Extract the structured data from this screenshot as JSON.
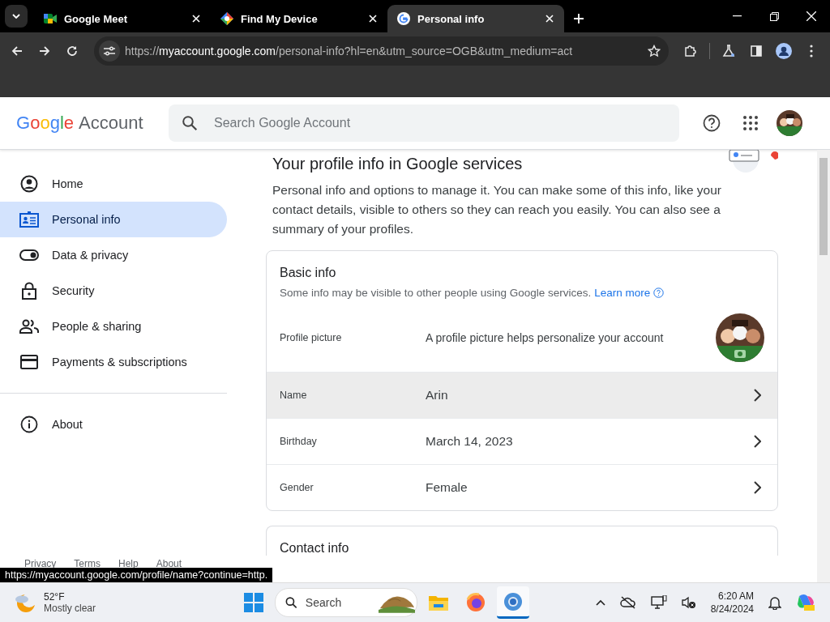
{
  "browser": {
    "tabs": [
      {
        "title": "Google Meet",
        "selected": false
      },
      {
        "title": "Find My Device",
        "selected": false
      },
      {
        "title": "Personal info",
        "selected": true
      }
    ],
    "url": {
      "scheme": "https://",
      "host": "myaccount.google.com",
      "path": "/personal-info?hl=en&utm_source=OGB&utm_medium=act"
    }
  },
  "header": {
    "logo": "Google",
    "product": "Account",
    "search_placeholder": "Search Google Account"
  },
  "sidebar": {
    "items": [
      {
        "label": "Home",
        "selected": false
      },
      {
        "label": "Personal info",
        "selected": true
      },
      {
        "label": "Data & privacy",
        "selected": false
      },
      {
        "label": "Security",
        "selected": false
      },
      {
        "label": "People & sharing",
        "selected": false
      },
      {
        "label": "Payments & subscriptions",
        "selected": false
      }
    ],
    "about": {
      "label": "About",
      "selected": false
    },
    "footer_links": [
      "Privacy",
      "Terms",
      "Help",
      "About"
    ]
  },
  "main": {
    "heading": "Your profile info in Google services",
    "intro": "Personal info and options to manage it. You can make some of this info, like your contact details, visible to others so they can reach you easily. You can also see a summary of your profiles.",
    "basic_info": {
      "title": "Basic info",
      "subtitle": "Some info may be visible to other people using Google services.",
      "link": "Learn more",
      "rows": [
        {
          "kind": "picture",
          "label": "Profile picture",
          "value": "A profile picture helps personalize your account",
          "hovered": false
        },
        {
          "kind": "field",
          "label": "Name",
          "value": "Arin",
          "hovered": true
        },
        {
          "kind": "field",
          "label": "Birthday",
          "value": "March 14, 2023",
          "hovered": false
        },
        {
          "kind": "field",
          "label": "Gender",
          "value": "Female",
          "hovered": false
        }
      ]
    },
    "contact_info": {
      "title": "Contact info"
    }
  },
  "status_url": "https://myaccount.google.com/profile/name?continue=http.",
  "taskbar": {
    "weather": {
      "temp": "52°F",
      "condition": "Mostly clear"
    },
    "search_placeholder": "Search",
    "time": "6:20 AM",
    "date": "8/24/2024"
  }
}
